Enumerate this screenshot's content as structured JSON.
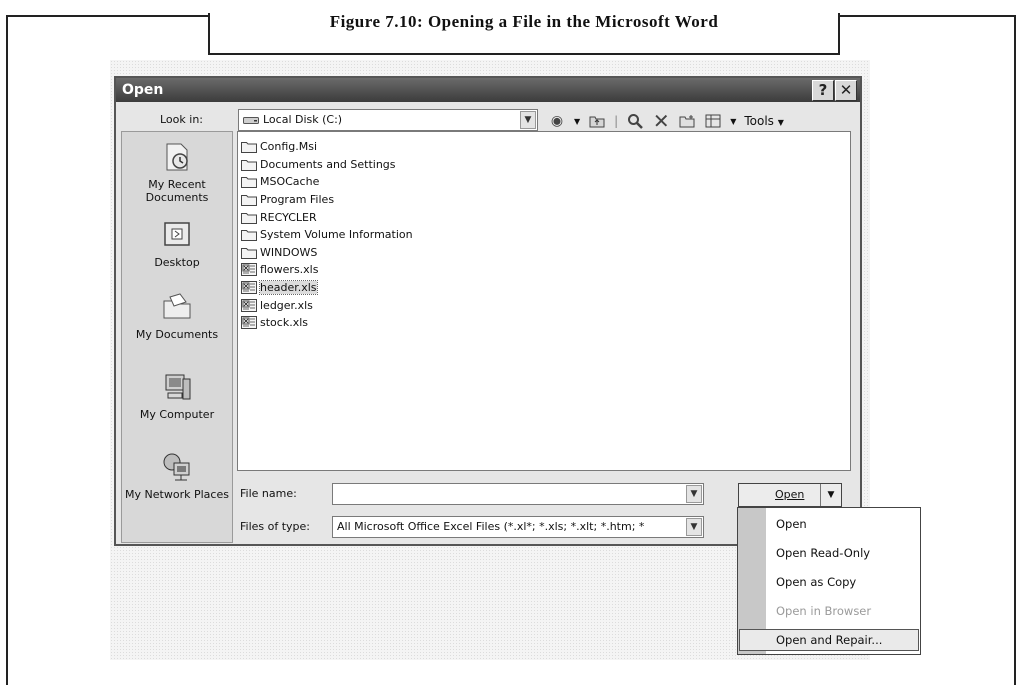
{
  "figure": {
    "caption": "Figure 7.10: Opening a File in the Microsoft Word"
  },
  "dialog": {
    "title": "Open",
    "help_label": "?",
    "close_label": "✕",
    "look_in_label": "Look in:",
    "look_in_value": "Local Disk (C:)",
    "toolbar": {
      "tools_label": "Tools"
    },
    "places": [
      {
        "label": "My Recent Documents"
      },
      {
        "label": "Desktop"
      },
      {
        "label": "My Documents"
      },
      {
        "label": "My Computer"
      },
      {
        "label": "My Network Places"
      }
    ],
    "files": [
      {
        "name": "Config.Msi",
        "type": "folder"
      },
      {
        "name": "Documents and Settings",
        "type": "folder"
      },
      {
        "name": "MSOCache",
        "type": "folder"
      },
      {
        "name": "Program Files",
        "type": "folder"
      },
      {
        "name": "RECYCLER",
        "type": "folder"
      },
      {
        "name": "System Volume Information",
        "type": "folder"
      },
      {
        "name": "WINDOWS",
        "type": "folder"
      },
      {
        "name": "flowers.xls",
        "type": "xls"
      },
      {
        "name": "header.xls",
        "type": "xls",
        "selected": true
      },
      {
        "name": "ledger.xls",
        "type": "xls"
      },
      {
        "name": "stock.xls",
        "type": "xls"
      }
    ],
    "file_name_label": "File name:",
    "file_name_value": "",
    "files_of_type_label": "Files of type:",
    "files_of_type_value": "All Microsoft Office Excel Files (*.xl*; *.xls; *.xlt; *.htm; *",
    "open_button_label": "Open",
    "open_menu": [
      {
        "label": "Open",
        "enabled": true
      },
      {
        "label": "Open Read-Only",
        "enabled": true
      },
      {
        "label": "Open as Copy",
        "enabled": true
      },
      {
        "label": "Open in Browser",
        "enabled": false
      },
      {
        "label": "Open and Repair...",
        "enabled": true,
        "highlighted": true
      }
    ]
  }
}
